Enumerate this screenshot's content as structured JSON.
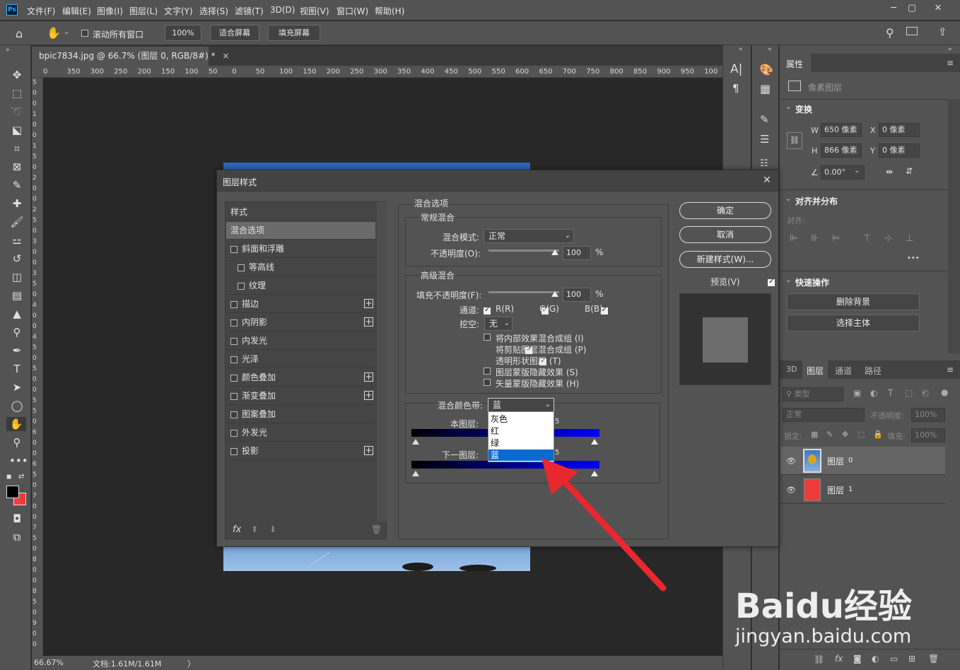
{
  "app": {
    "logo": "Ps",
    "menus": [
      "文件(F)",
      "编辑(E)",
      "图像(I)",
      "图层(L)",
      "文字(Y)",
      "选择(S)",
      "滤镜(T)",
      "3D(D)",
      "视图(V)",
      "窗口(W)",
      "帮助(H)"
    ]
  },
  "options": {
    "scroll_all": "滚动所有窗口",
    "zoom": "100%",
    "fit_screen": "适合屏幕",
    "fill_screen": "填充屏幕"
  },
  "document": {
    "tab": "bpic7834.jpg @ 66.7% (图层 0, RGB/8#) *",
    "close": "×"
  },
  "ruler": {
    "h": [
      "0",
      "350",
      "300",
      "250",
      "200",
      "150",
      "100",
      "50",
      "0",
      "50",
      "100",
      "150",
      "200",
      "250",
      "300",
      "350",
      "400",
      "450",
      "500",
      "550",
      "600",
      "650",
      "700",
      "750",
      "800",
      "850",
      "900",
      "950",
      "100"
    ],
    "v": [
      "5",
      "0",
      "0",
      "1",
      "0",
      "0",
      "1",
      "5",
      "0",
      "2",
      "0",
      "0",
      "2",
      "5",
      "0",
      "3",
      "0",
      "0",
      "3",
      "5",
      "0",
      "4",
      "0",
      "0",
      "4",
      "5",
      "0",
      "5",
      "0",
      "0",
      "5",
      "5",
      "0",
      "6",
      "0",
      "0",
      "6",
      "5",
      "0",
      "7",
      "0",
      "0",
      "7",
      "5",
      "0",
      "8",
      "0",
      "0",
      "8",
      "5",
      "0",
      "9",
      "0",
      "0"
    ]
  },
  "status": {
    "zoom": "66.67%",
    "doc": "文档:1.61M/1.61M",
    "caret": "〉"
  },
  "properties": {
    "tab": "属性",
    "pixel_layer": "像素图层",
    "transform": "变换",
    "w_label": "W",
    "w_value": "650 像素",
    "x_label": "X",
    "x_value": "0 像素",
    "h_label": "H",
    "h_value": "866 像素",
    "y_label": "Y",
    "y_value": "0 像素",
    "angle": "0.00°",
    "align_title": "对齐并分布",
    "align_sub": "对齐:",
    "more": "•••",
    "quick_title": "快速操作",
    "remove_bg": "删除背景",
    "select_subject": "选择主体"
  },
  "layers_panel": {
    "tabs": [
      "3D",
      "图层",
      "通道",
      "路径"
    ],
    "kind": "类型",
    "mode": "正常",
    "opacity_label": "不透明度:",
    "opacity": "100%",
    "lock_label": "锁定:",
    "fill_label": "填充:",
    "fill": "100%",
    "layers": [
      {
        "name": "图层",
        "num": "0"
      },
      {
        "name": "图层",
        "num": "1"
      }
    ]
  },
  "dialog": {
    "title": "图层样式",
    "close": "✕",
    "styles_header": "样式",
    "blend_options": "混合选项",
    "styles": [
      {
        "label": "斜面和浮雕",
        "indent": false,
        "plus": false
      },
      {
        "label": "等高线",
        "indent": true,
        "plus": false
      },
      {
        "label": "纹理",
        "indent": true,
        "plus": false
      },
      {
        "label": "描边",
        "indent": false,
        "plus": true
      },
      {
        "label": "内阴影",
        "indent": false,
        "plus": true
      },
      {
        "label": "内发光",
        "indent": false,
        "plus": false
      },
      {
        "label": "光泽",
        "indent": false,
        "plus": false
      },
      {
        "label": "颜色叠加",
        "indent": false,
        "plus": true
      },
      {
        "label": "渐变叠加",
        "indent": false,
        "plus": true
      },
      {
        "label": "图案叠加",
        "indent": false,
        "plus": false
      },
      {
        "label": "外发光",
        "indent": false,
        "plus": false
      },
      {
        "label": "投影",
        "indent": false,
        "plus": true
      }
    ],
    "fx": "fx",
    "section_title": "混合选项",
    "general": "常规混合",
    "blend_mode_label": "混合模式:",
    "blend_mode": "正常",
    "opacity_label": "不透明度(O):",
    "opacity": "100",
    "pct": "%",
    "advanced": "高级混合",
    "fill_opacity_label": "填充不透明度(F):",
    "fill_opacity": "100",
    "channels_label": "通道:",
    "ch_r": "R(R)",
    "ch_g": "G(G)",
    "ch_b": "B(B)",
    "knockout_label": "挖空:",
    "knockout": "无",
    "opt1": "将内部效果混合成组 (I)",
    "opt2": "将剪贴图层混合成组 (P)",
    "opt3": "透明形状图层 (T)",
    "opt4": "图层蒙版隐藏效果 (S)",
    "opt5": "矢量蒙版隐藏效果 (H)",
    "blend_if_label": "混合颜色带:",
    "blend_if": "蓝",
    "this_layer": "本图层:",
    "underlying": "下一图层:",
    "max_hidden": "5",
    "dropdown": [
      "灰色",
      "红",
      "绿",
      "蓝"
    ],
    "ok": "确定",
    "cancel": "取消",
    "new_style": "新建样式(W)...",
    "preview": "预览(V)"
  },
  "watermark": {
    "line1": "Baidu经验",
    "line2": "jingyan.baidu.com"
  },
  "colors": {
    "accent": "#0b6ad0",
    "arrow": "#e8272e",
    "layer1": "#ee3b3b",
    "blue_band": "#0000ff"
  }
}
